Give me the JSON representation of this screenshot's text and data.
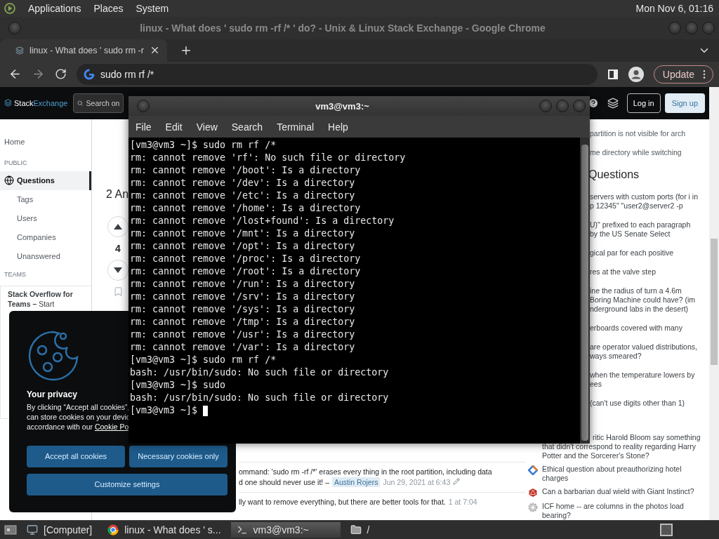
{
  "top_panel": {
    "menus": [
      "Applications",
      "Places",
      "System"
    ],
    "clock": "Mon Nov 6, 01:16"
  },
  "browser": {
    "window_title": "linux - What does ' sudo rm -rf /* ' do? - Unix & Linux Stack Exchange - Google Chrome",
    "tab": {
      "title": "linux - What does ' sudo rm -r"
    },
    "address": "sudo rm rf /*",
    "update_button": "Update",
    "site_header": {
      "logo": {
        "first": "Stack",
        "second": "Exchange"
      },
      "search_placeholder": "Search on",
      "login": "Log in",
      "signup": "Sign up"
    },
    "sidebar": {
      "home": "Home",
      "sections": [
        {
          "heading": "PUBLIC",
          "items": [
            {
              "label": "Questions",
              "selected": true
            },
            {
              "label": "Tags",
              "selected": false
            },
            {
              "label": "Users",
              "selected": false
            },
            {
              "label": "Companies",
              "selected": false
            },
            {
              "label": "Unanswered",
              "selected": false
            }
          ]
        },
        {
          "heading": "TEAMS"
        }
      ],
      "teams_promo": "**Stack Overflow for Teams –** Start"
    },
    "answers_heading": "2 An",
    "vote_count": "4",
    "comments": [
      {
        "text": "ommand: 'sudo rm -rf /*' erases every thing in the root partition, including data\nd one should never use it! –",
        "user": "Austin Rojers",
        "date": "Jun 29, 2021 at 6:43",
        "edited": true
      },
      {
        "text": "lly want to remove everything, but there are better tools for that.",
        "date": "1 at 7:04",
        "edited": false
      }
    ],
    "right_sidebar": {
      "top_fragments": [
        "partition is not visible for arch",
        "me directory while switching"
      ],
      "heading": "Questions",
      "question_fragments": [
        "servers with custom ports (for i in\np 12345\" \"user2@server2 -p",
        "U)\" prefixed to each paragraph\nby the US Senate Select",
        "gical par for each positive",
        "res at the valve step",
        "ine the radius of turn a 4.6m\nBoring Machine could have? (im\nnderground labs in the desert)",
        "erboards covered with many",
        "are operator valued distributions,\nways smeared?",
        "when the temperature lowers by\nees",
        "(can't use digits other than 1)"
      ],
      "questions": [
        {
          "kind": "none",
          "text": "ritic Harold Bloom say something\nthat didn't correspond to reality regarding Harry\nPotter and the Sorcerer's Stone?"
        },
        {
          "kind": "diamond",
          "text": "Ethical question about preauthorizing hotel\ncharges"
        },
        {
          "kind": "die",
          "text": "Can a barbarian dual wield with Giant Instinct?"
        },
        {
          "kind": "gear",
          "text": "ICF home -- are columns in the photos load\nbearing?"
        }
      ]
    }
  },
  "cookie_banner": {
    "title": "Your privacy",
    "text": "By clicking “Accept all cookies”,\ncan store cookies on your devic\naccordance with our ",
    "link": "Cookie Po",
    "buttons": [
      {
        "label": "Accept all cookies",
        "kind": "half"
      },
      {
        "label": "Necessary cookies only",
        "kind": "half"
      },
      {
        "label": "Customize settings",
        "kind": "full"
      }
    ]
  },
  "terminal": {
    "title": "vm3@vm3:~",
    "menus": [
      "File",
      "Edit",
      "View",
      "Search",
      "Terminal",
      "Help"
    ],
    "lines": [
      "[vm3@vm3 ~]$ sudo rm rf /*",
      "rm: cannot remove 'rf': No such file or directory",
      "rm: cannot remove '/boot': Is a directory",
      "rm: cannot remove '/dev': Is a directory",
      "rm: cannot remove '/etc': Is a directory",
      "rm: cannot remove '/home': Is a directory",
      "rm: cannot remove '/lost+found': Is a directory",
      "rm: cannot remove '/mnt': Is a directory",
      "rm: cannot remove '/opt': Is a directory",
      "rm: cannot remove '/proc': Is a directory",
      "rm: cannot remove '/root': Is a directory",
      "rm: cannot remove '/run': Is a directory",
      "rm: cannot remove '/srv': Is a directory",
      "rm: cannot remove '/sys': Is a directory",
      "rm: cannot remove '/tmp': Is a directory",
      "rm: cannot remove '/usr': Is a directory",
      "rm: cannot remove '/var': Is a directory",
      "[vm3@vm3 ~]$ sudo rm rf /*",
      "bash: /usr/bin/sudo: No such file or directory",
      "[vm3@vm3 ~]$ sudo",
      "bash: /usr/bin/sudo: No such file or directory",
      "[vm3@vm3 ~]$ "
    ]
  },
  "taskbar": {
    "items": [
      {
        "kind": "computer",
        "label": "[Computer]",
        "selected": false
      },
      {
        "kind": "browser",
        "label": "linux - What does ' s...",
        "selected": false
      },
      {
        "kind": "terminal",
        "label": "vm3@vm3:~",
        "selected": true
      },
      {
        "kind": "folder",
        "label": "/",
        "selected": false
      }
    ]
  }
}
